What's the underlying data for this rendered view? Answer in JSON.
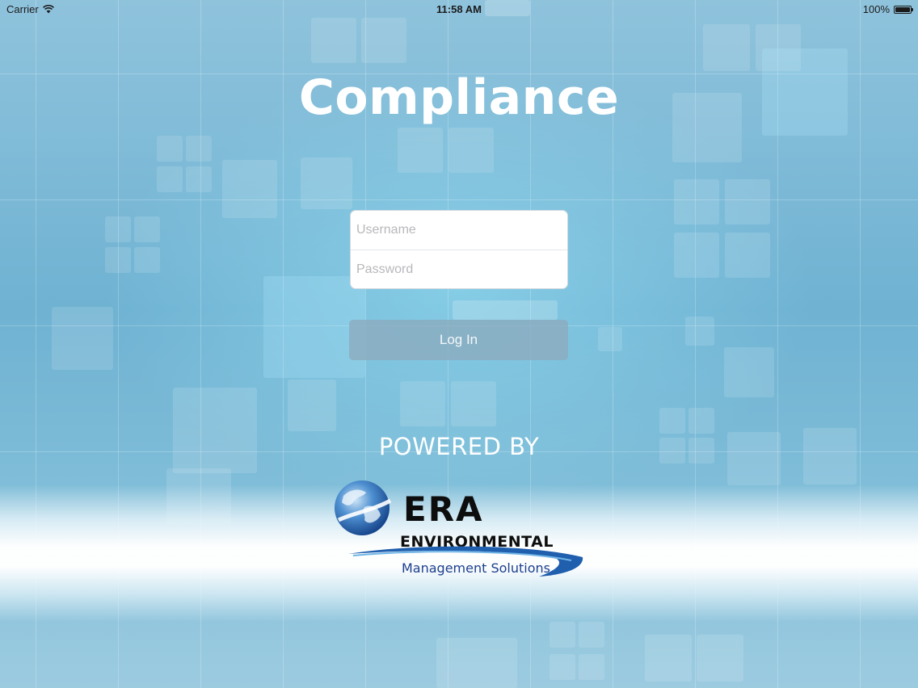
{
  "status_bar": {
    "carrier": "Carrier",
    "time": "11:58 AM",
    "battery": "100%",
    "battery_level": 1.0,
    "wifi_icon": "wifi-icon",
    "battery_icon": "battery-icon"
  },
  "app": {
    "title": "Compliance"
  },
  "login": {
    "username_placeholder": "Username",
    "username_value": "",
    "password_placeholder": "Password",
    "password_value": "",
    "button_label": "Log In"
  },
  "footer": {
    "powered_by": "POWERED BY",
    "logo": {
      "name": "ERA",
      "line2": "ENVIRONMENTAL",
      "tagline": "Management Solutions"
    }
  },
  "colors": {
    "background": "#7fbdd8",
    "title": "#ffffff",
    "button": "#8caabe",
    "logo_blue": "#1d3f8e"
  }
}
